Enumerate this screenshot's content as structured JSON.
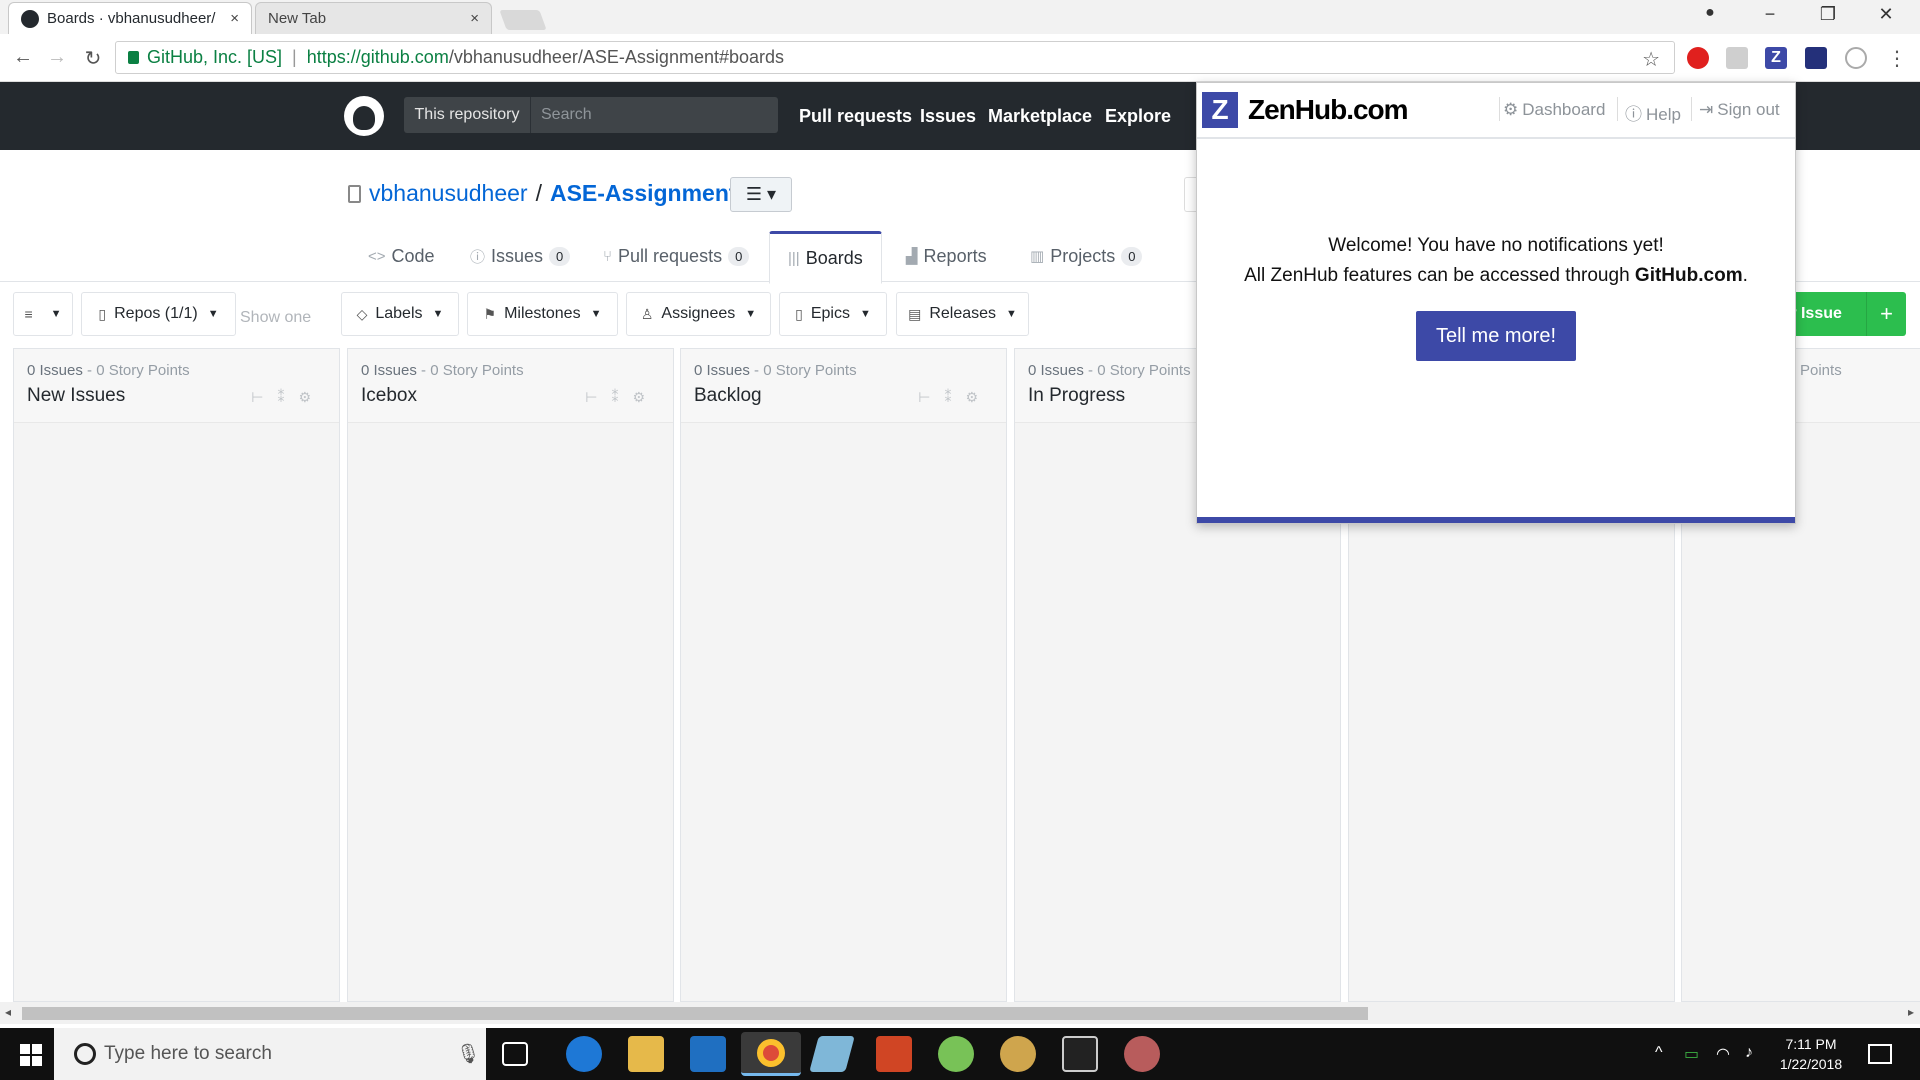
{
  "browser": {
    "tabs": [
      {
        "title": "Boards · vbhanusudheer/",
        "close": "×"
      },
      {
        "title": "New Tab",
        "close": "×"
      }
    ],
    "secure_label": "GitHub, Inc. [US]",
    "url_host": "https://github.com",
    "url_path": "/vbhanusudheer/ASE-Assignment#boards",
    "star": "☆",
    "window_controls": [
      "−",
      "❐",
      "✕"
    ]
  },
  "github": {
    "scope_label": "This repository",
    "search_placeholder": "Search",
    "nav": [
      "Pull requests",
      "Issues",
      "Marketplace",
      "Explore"
    ]
  },
  "repo": {
    "owner": "vbhanusudheer",
    "slash": "/",
    "name": "ASE-Assignment",
    "tabs": [
      {
        "label": "Code",
        "icon": "<>",
        "count": ""
      },
      {
        "label": "Issues",
        "icon": "ⓘ",
        "count": "0"
      },
      {
        "label": "Pull requests",
        "icon": "⑂",
        "count": "0"
      },
      {
        "label": "Boards",
        "icon": "|||",
        "count": ""
      },
      {
        "label": "Reports",
        "icon": "▟",
        "count": ""
      },
      {
        "label": "Projects",
        "icon": "▥",
        "count": "0"
      }
    ]
  },
  "filters": {
    "items": [
      {
        "label": "",
        "icon": "≡"
      },
      {
        "label": "Repos (1/1)",
        "icon": "▯"
      },
      {
        "label": "Labels",
        "icon": "◇"
      },
      {
        "label": "Milestones",
        "icon": "⚑"
      },
      {
        "label": "Assignees",
        "icon": "♙"
      },
      {
        "label": "Epics",
        "icon": "▯"
      },
      {
        "label": "Releases",
        "icon": "▤"
      }
    ],
    "show_one": "Show one",
    "new_issue": "w Issue",
    "plus": "+"
  },
  "board": {
    "pipelines": [
      {
        "meta": "0 Issues",
        "points": "- 0 Story Points",
        "name": "New Issues"
      },
      {
        "meta": "0 Issues",
        "points": "- 0 Story Points",
        "name": "Icebox"
      },
      {
        "meta": "0 Issues",
        "points": "- 0 Story Points",
        "name": "Backlog"
      },
      {
        "meta": "0 Issues",
        "points": "- 0 Story Points",
        "name": "In Progress"
      },
      {
        "meta": "",
        "points": "",
        "name": ""
      },
      {
        "meta": "",
        "points": "",
        "name": ""
      },
      {
        "meta": "",
        "points": "ory Points",
        "name": ""
      }
    ]
  },
  "zenhub": {
    "brand": "ZenHub.com",
    "logo_letter": "Z",
    "links": [
      "Dashboard",
      "Help",
      "Sign out"
    ],
    "welcome": "Welcome! You have no notifications yet!",
    "access_prefix": "All ZenHub features can be accessed through ",
    "access_link": "GitHub.com",
    "access_suffix": ".",
    "button": "Tell me more!",
    "accent": "#3d49a7"
  },
  "taskbar": {
    "search_placeholder": "Type here to search",
    "time": "7:11 PM",
    "date": "1/22/2018"
  }
}
